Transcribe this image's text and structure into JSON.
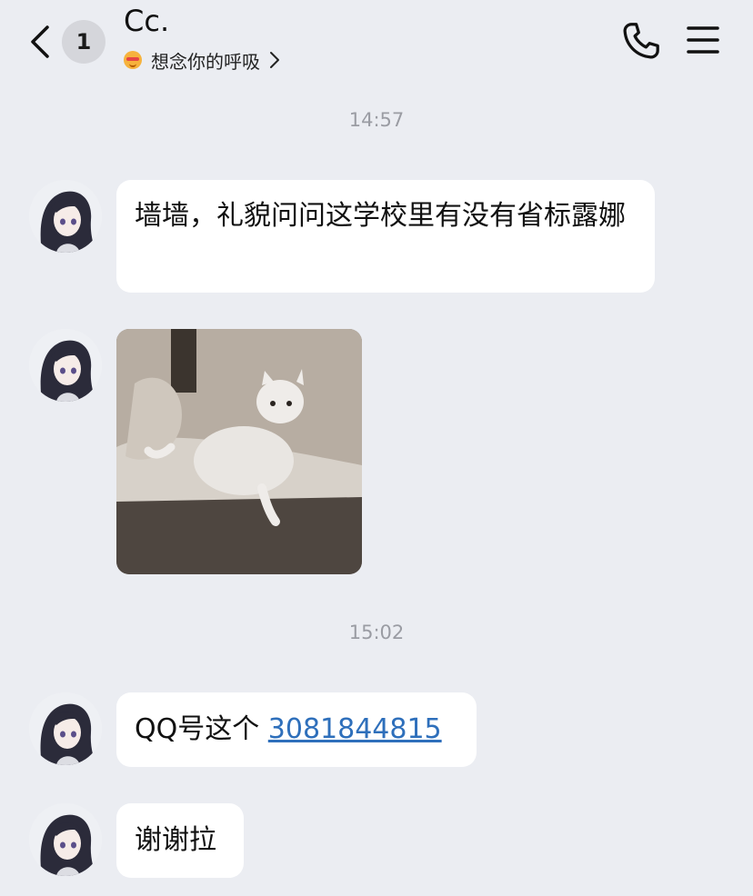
{
  "header": {
    "unread_count": "1",
    "contact_name": "Cc.",
    "status_text": "想念你的呼吸"
  },
  "messages": {
    "timestamp_1": "14:57",
    "msg1_text": "墙墙，礼貌问问这学校里有没有省标露娜",
    "timestamp_2": "15:02",
    "msg3_prefix": "QQ号这个 ",
    "msg3_link": "3081844815",
    "msg4_text": "谢谢拉"
  },
  "icons": {
    "back": "chevron-left-icon",
    "phone": "phone-icon",
    "menu": "hamburger-menu-icon",
    "status_emoji": "blushing-face-icon"
  },
  "colors": {
    "background": "#ebedf2",
    "bubble": "#ffffff",
    "link": "#2e6fbb",
    "timestamp": "#9a9ca3"
  }
}
